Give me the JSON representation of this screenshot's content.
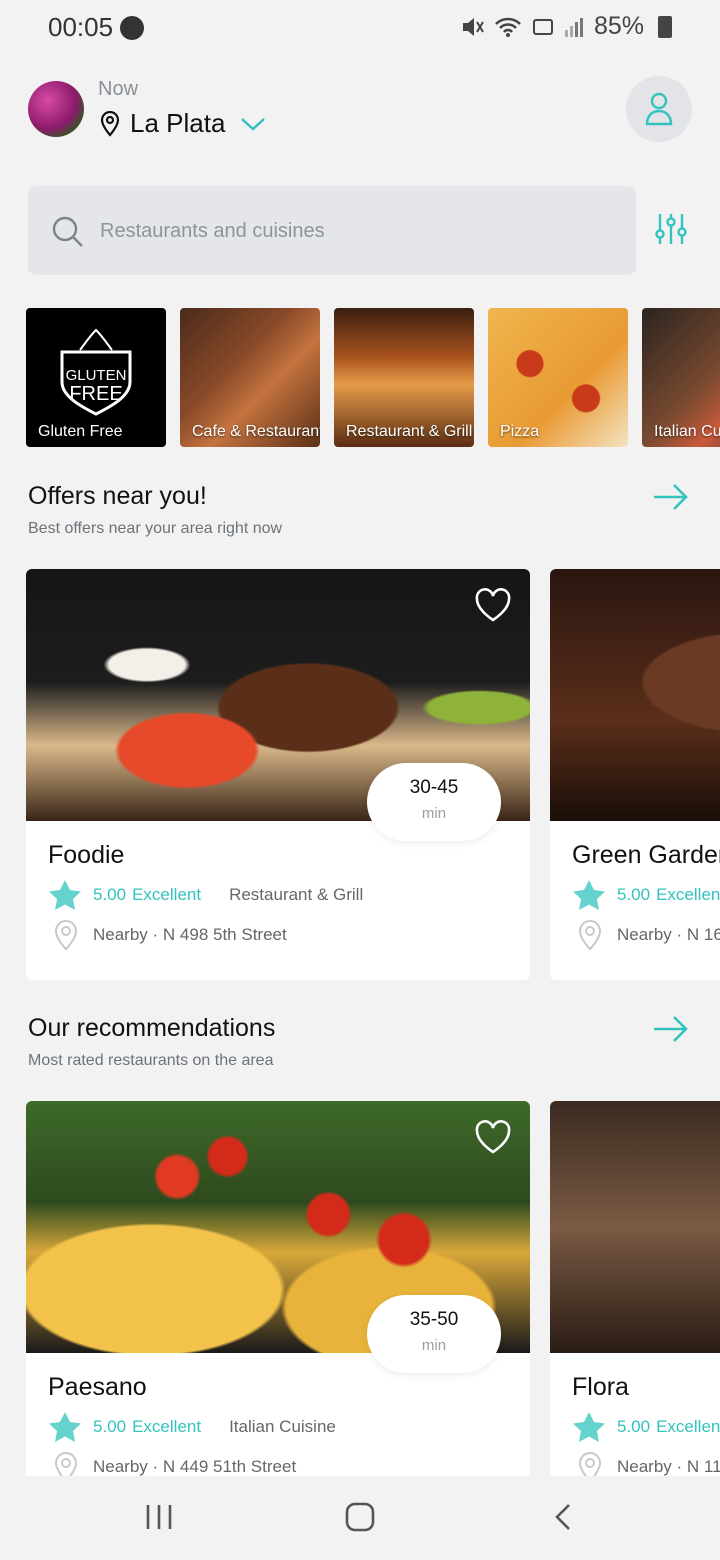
{
  "status_bar": {
    "time": "00:05",
    "battery": "85%"
  },
  "header": {
    "location_label": "Now",
    "city": "La Plata"
  },
  "search": {
    "placeholder": "Restaurants and cuisines"
  },
  "categories": [
    {
      "label": "Gluten Free"
    },
    {
      "label": "Cafe & Restaurant"
    },
    {
      "label": "Restaurant & Grill"
    },
    {
      "label": "Pizza"
    },
    {
      "label": "Italian Cuisine"
    }
  ],
  "gluten_badge": {
    "line1": "GLUTEN",
    "line2": "FREE"
  },
  "offers": {
    "title": "Offers near you!",
    "subtitle": "Best offers near your area right now",
    "cards": [
      {
        "name": "Foodie",
        "rating": "5.00",
        "rating_label": "Excellent",
        "cuisine": "Restaurant & Grill",
        "address": "Nearby · N 498 5th Street",
        "time_range": "30-45",
        "time_unit": "min"
      },
      {
        "name": "Green Garden",
        "rating": "5.00",
        "rating_label": "Excellent",
        "cuisine": "",
        "address": "Nearby · N 16",
        "time_range": "",
        "time_unit": ""
      }
    ]
  },
  "recommendations": {
    "title": "Our recommendations",
    "subtitle": "Most rated restaurants on the area",
    "cards": [
      {
        "name": "Paesano",
        "rating": "5.00",
        "rating_label": "Excellent",
        "cuisine": "Italian Cuisine",
        "address": "Nearby · N 449 51th Street",
        "time_range": "35-50",
        "time_unit": "min"
      },
      {
        "name": "Flora",
        "rating": "5.00",
        "rating_label": "Excellent",
        "cuisine": "",
        "address": "Nearby · N 11",
        "time_range": "",
        "time_unit": ""
      }
    ]
  },
  "colors": {
    "accent": "#33c3be",
    "background": "#f2f2f2",
    "card": "#ffffff",
    "search_bg": "#e4e6ea"
  }
}
